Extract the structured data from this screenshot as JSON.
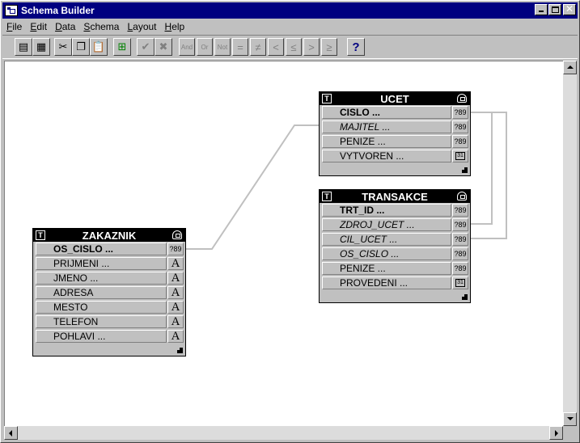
{
  "window": {
    "title": "Schema Builder"
  },
  "menu": [
    {
      "label": "File",
      "mnemonic": "F",
      "rest": "ile"
    },
    {
      "label": "Edit",
      "mnemonic": "E",
      "rest": "dit"
    },
    {
      "label": "Data",
      "mnemonic": "D",
      "rest": "ata"
    },
    {
      "label": "Schema",
      "mnemonic": "S",
      "rest": "chema"
    },
    {
      "label": "Layout",
      "mnemonic": "L",
      "rest": "ayout"
    },
    {
      "label": "Help",
      "mnemonic": "H",
      "rest": "elp"
    }
  ],
  "toolbar": {
    "and_label": "And",
    "or_label": "Or",
    "not_label": "Not",
    "help_label": "?"
  },
  "entities": [
    {
      "name": "UCET",
      "fields": [
        {
          "name": "CISLO ...",
          "kind": "key",
          "type": "number"
        },
        {
          "name": "MAJITEL ...",
          "kind": "fk",
          "type": "number"
        },
        {
          "name": "PENIZE ...",
          "kind": "normal",
          "type": "number"
        },
        {
          "name": "VYTVOREN ...",
          "kind": "normal",
          "type": "date"
        }
      ]
    },
    {
      "name": "TRANSAKCE",
      "fields": [
        {
          "name": "TRT_ID ...",
          "kind": "key",
          "type": "number"
        },
        {
          "name": "ZDROJ_UCET ...",
          "kind": "fk",
          "type": "number"
        },
        {
          "name": "CIL_UCET ...",
          "kind": "fk",
          "type": "number"
        },
        {
          "name": "OS_CISLO ...",
          "kind": "fk",
          "type": "number"
        },
        {
          "name": "PENIZE ...",
          "kind": "normal",
          "type": "number"
        },
        {
          "name": "PROVEDENI ...",
          "kind": "normal",
          "type": "date"
        }
      ]
    },
    {
      "name": "ZAKAZNIK",
      "fields": [
        {
          "name": "OS_CISLO ...",
          "kind": "key",
          "type": "number"
        },
        {
          "name": "PRIJMENI ...",
          "kind": "normal",
          "type": "text"
        },
        {
          "name": "JMENO ...",
          "kind": "normal",
          "type": "text"
        },
        {
          "name": "ADRESA",
          "kind": "normal",
          "type": "text"
        },
        {
          "name": "MESTO",
          "kind": "normal",
          "type": "text"
        },
        {
          "name": "TELEFON",
          "kind": "normal",
          "type": "text"
        },
        {
          "name": "POHLAVI ...",
          "kind": "normal",
          "type": "text"
        }
      ]
    }
  ],
  "type_glyphs": {
    "number": "?89",
    "text": "A",
    "date": "31"
  },
  "entity_badge": "T",
  "colors": {
    "titlebar": "#000080",
    "canvas": "#ffffff",
    "link": "#c0c0c0",
    "chrome": "#c0c0c0"
  }
}
